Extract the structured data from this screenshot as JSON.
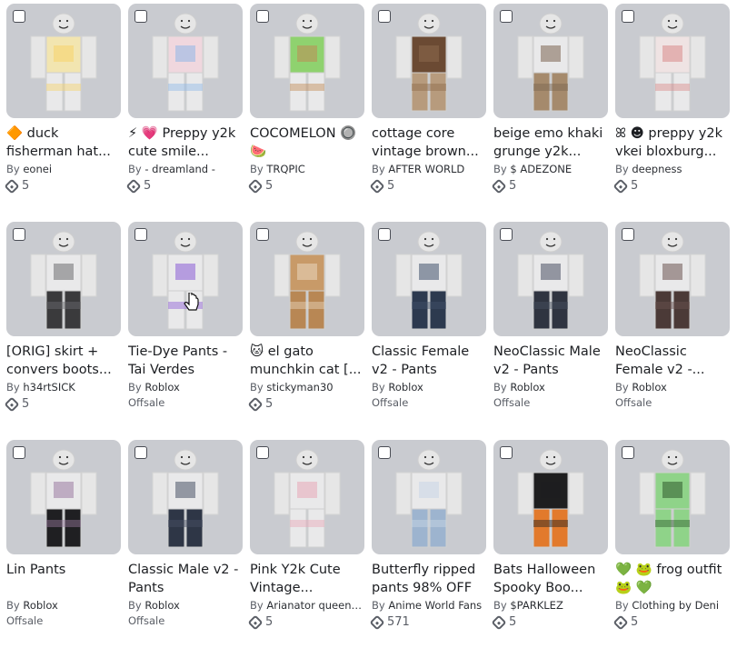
{
  "items": [
    {
      "title": "🔶 duck fisherman hat...",
      "creator": "eonei",
      "price": "5",
      "shirt": "#f2e5b0",
      "pants": "#e9e9ea",
      "detail": "#f7d36a"
    },
    {
      "title": "⚡ 💗 Preppy y2k cute smile...",
      "creator": "- dreamland -",
      "price": "5",
      "shirt": "#f0d7de",
      "pants": "#e9e9ea",
      "detail": "#8fb7e8"
    },
    {
      "title": "COCOMELON 🔘 🍉",
      "creator": "TRQPIC",
      "price": "5",
      "shirt": "#8fd26f",
      "pants": "#e9e9ea",
      "detail": "#c08a55"
    },
    {
      "title": "cottage core vintage brown...",
      "creator": "AFTER WORLD",
      "price": "5",
      "shirt": "#6b4a33",
      "pants": "#b79b7d",
      "detail": "#8d6a4c"
    },
    {
      "title": "beige emo khaki grunge y2k...",
      "creator": "$ ADEZONE",
      "price": "5",
      "shirt": "#e9e9ea",
      "pants": "#a58a6c",
      "detail": "#7b6450"
    },
    {
      "title": "ꕤ ☻ preppy y2k vkei bloxburg...",
      "creator": "deepness",
      "price": "5",
      "shirt": "#efe3e3",
      "pants": "#e9e9ea",
      "detail": "#d98a8a"
    },
    {
      "title": "[ORIG] skirt + convers boots...",
      "creator": "h34rtSICK",
      "price": "5",
      "shirt": "#e9e9ea",
      "pants": "#3a3a3c",
      "detail": "#6d6d70"
    },
    {
      "title": "Tie-Dye Pants - Tai Verdes",
      "creator": "Roblox",
      "offsale": "Offsale",
      "shirt": "#e9e9ea",
      "pants": "#e9e9ea",
      "detail": "#8b5cd6"
    },
    {
      "title": "🐱 el gato munchkin cat [...",
      "creator": "stickyman30",
      "price": "5",
      "shirt": "#c89a68",
      "pants": "#b88754",
      "detail": "#e9d7be"
    },
    {
      "title": "Classic Female v2 - Pants",
      "creator": "Roblox",
      "offsale": "Offsale",
      "shirt": "#e9e9ea",
      "pants": "#2d3a4f",
      "detail": "#42526b"
    },
    {
      "title": "NeoClassic Male v2 - Pants",
      "creator": "Roblox",
      "offsale": "Offsale",
      "shirt": "#e9e9ea",
      "pants": "#2f3440",
      "detail": "#4a5162"
    },
    {
      "title": "NeoClassic Female v2 -...",
      "creator": "Roblox",
      "offsale": "Offsale",
      "shirt": "#e9e9ea",
      "pants": "#4b3a37",
      "detail": "#6b5450"
    },
    {
      "title": "Lin Pants",
      "creator": "Roblox",
      "offsale": "Offsale",
      "shirt": "#e9e9ea",
      "pants": "#1f1f22",
      "detail": "#9a7aa0"
    },
    {
      "title": "Classic Male v2 - Pants",
      "creator": "Roblox",
      "offsale": "Offsale",
      "shirt": "#e9e9ea",
      "pants": "#2e3646",
      "detail": "#4a5366"
    },
    {
      "title": "Pink Y2k Cute Vintage...",
      "creator": "Arianator queens...",
      "price": "5",
      "shirt": "#e9e9ea",
      "pants": "#e9e9ea",
      "detail": "#e8a7b7"
    },
    {
      "title": "Butterfly ripped pants 98% OFF",
      "creator": "Anime World Fans",
      "price": "571",
      "shirt": "#e9e9ea",
      "pants": "#9db4cf",
      "detail": "#c9d6e5"
    },
    {
      "title": "Bats Halloween Spooky Boo...",
      "creator": "$PARKLEZ",
      "price": "5",
      "shirt": "#1e1e1f",
      "pants": "#e27a2c",
      "detail": "#1e1e1f"
    },
    {
      "title": "💚 🐸 frog outfit 🐸 💚",
      "creator": "Clothing by Deni",
      "price": "5",
      "shirt": "#8fd389",
      "pants": "#8fd389",
      "detail": "#2f5a2c"
    }
  ],
  "labels": {
    "by": "By"
  }
}
